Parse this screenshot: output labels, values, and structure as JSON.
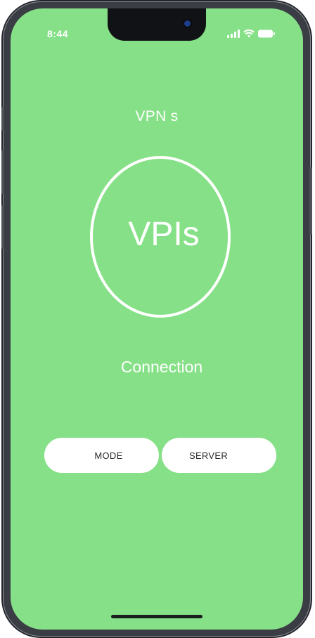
{
  "status_bar": {
    "time": "8:44",
    "icons": [
      "signal-icon",
      "wifi-icon",
      "battery-icon"
    ]
  },
  "main": {
    "title": "VPN s",
    "circle_label": "VPIs",
    "status_text": "Connection"
  },
  "buttons": {
    "mode_label": "MODE",
    "server_label": "SERVER"
  },
  "colors": {
    "background": "#86e087",
    "foreground": "#ffffff",
    "frame": "#3b3d45"
  }
}
